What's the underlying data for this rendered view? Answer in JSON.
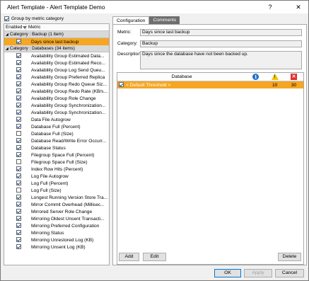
{
  "window": {
    "title": "Alert Template - Alert Template Demo",
    "help_glyph": "?",
    "close_glyph": "✕"
  },
  "left": {
    "group_by_label": "Group by metric category",
    "group_by_checked": true,
    "col_enabled": "Enabled",
    "col_metric": "Metric",
    "category_backup": "Category : Backup (1 item)",
    "category_databases": "Category : Databases (34 items)",
    "backup_items": [
      {
        "label": "Days since last backup",
        "checked": true,
        "selected": true
      }
    ],
    "database_items": [
      {
        "label": "Availability Group Estimated Data...",
        "checked": true
      },
      {
        "label": "Availability Group Estimated Reco...",
        "checked": true
      },
      {
        "label": "Availability Group Log Send Queu...",
        "checked": true
      },
      {
        "label": "Availability Group Preferred Replica",
        "checked": true
      },
      {
        "label": "Availability Group Redo Queue Siz...",
        "checked": true
      },
      {
        "label": "Availability Group Redo Rate (KB/s...",
        "checked": true
      },
      {
        "label": "Availability Group Role Change",
        "checked": true
      },
      {
        "label": "Availability Group Synchronization...",
        "checked": true
      },
      {
        "label": "Availability Group Synchronization...",
        "checked": true
      },
      {
        "label": "Data File Autogrow",
        "checked": true
      },
      {
        "label": "Database Full (Percent)",
        "checked": true
      },
      {
        "label": "Database Full (Size)",
        "checked": false
      },
      {
        "label": "Database Read/Write Error Occurr...",
        "checked": true
      },
      {
        "label": "Database Status",
        "checked": true
      },
      {
        "label": "Filegroup Space Full (Percent)",
        "checked": true
      },
      {
        "label": "Filegroup Space Full (Size)",
        "checked": false
      },
      {
        "label": "Index Row Hits (Percent)",
        "checked": true
      },
      {
        "label": "Log File Autogrow",
        "checked": true
      },
      {
        "label": "Log Full (Percent)",
        "checked": true
      },
      {
        "label": "Log Full (Size)",
        "checked": false
      },
      {
        "label": "Longest Running Version Store Tra...",
        "checked": true
      },
      {
        "label": "Mirror Commit Overhead (Millisec...",
        "checked": true
      },
      {
        "label": "Mirrored Server Role Change",
        "checked": true
      },
      {
        "label": "Mirroring Oldest Unsent Transacti...",
        "checked": true
      },
      {
        "label": "Mirroring Preferred Configuration",
        "checked": true
      },
      {
        "label": "Mirroring Status",
        "checked": true
      },
      {
        "label": "Mirroring Unrestored Log (KB)",
        "checked": true
      },
      {
        "label": "Mirroring Unsent Log (KB)",
        "checked": true
      }
    ]
  },
  "tabs": [
    {
      "label": "Configuration",
      "active": true
    },
    {
      "label": "Comments",
      "active": false
    }
  ],
  "config": {
    "metric_label": "Metric:",
    "metric_value": "Days since last backup",
    "category_label": "Category:",
    "category_value": "Backup",
    "description_label": "Description:",
    "description_value": "Days since the database have not been backed up.",
    "grid_col_database": "Database",
    "threshold_row": {
      "name": "< Default Threshold >",
      "checked": true,
      "info": "",
      "warning": "10",
      "critical": "30"
    },
    "add_label": "Add",
    "edit_label": "Edit",
    "delete_label": "Delete"
  },
  "footer": {
    "ok_label": "OK",
    "apply_label": "Apply",
    "cancel_label": "Cancel"
  },
  "colors": {
    "selection": "#f5a623",
    "category_bar": "#d9d9d9",
    "info": "#1f6fd1",
    "warning": "#f2c200",
    "critical": "#e0302c"
  }
}
